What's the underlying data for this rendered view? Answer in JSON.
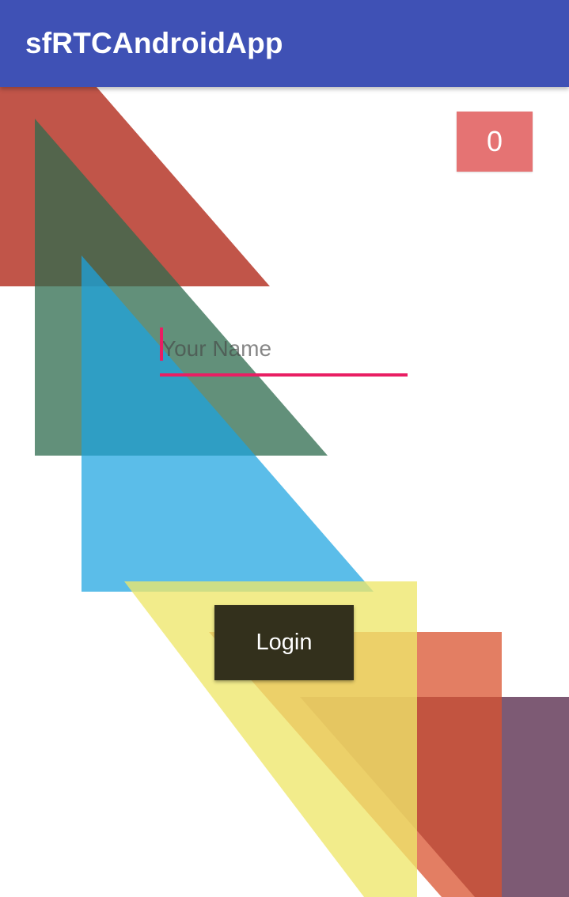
{
  "app_bar": {
    "title": "sfRTCAndroidApp",
    "color": "#3f51b5"
  },
  "counter": {
    "value": "0",
    "color": "#e57373"
  },
  "name_input": {
    "placeholder": "Your Name",
    "value": "",
    "accent_color": "#e91e63"
  },
  "login": {
    "label": "Login",
    "color": "#33301c"
  },
  "background_shape_colors": [
    "#b83c2e",
    "#2e6b4e",
    "#39ace0",
    "#eee76a",
    "#dd5a3c",
    "#6b4361"
  ]
}
